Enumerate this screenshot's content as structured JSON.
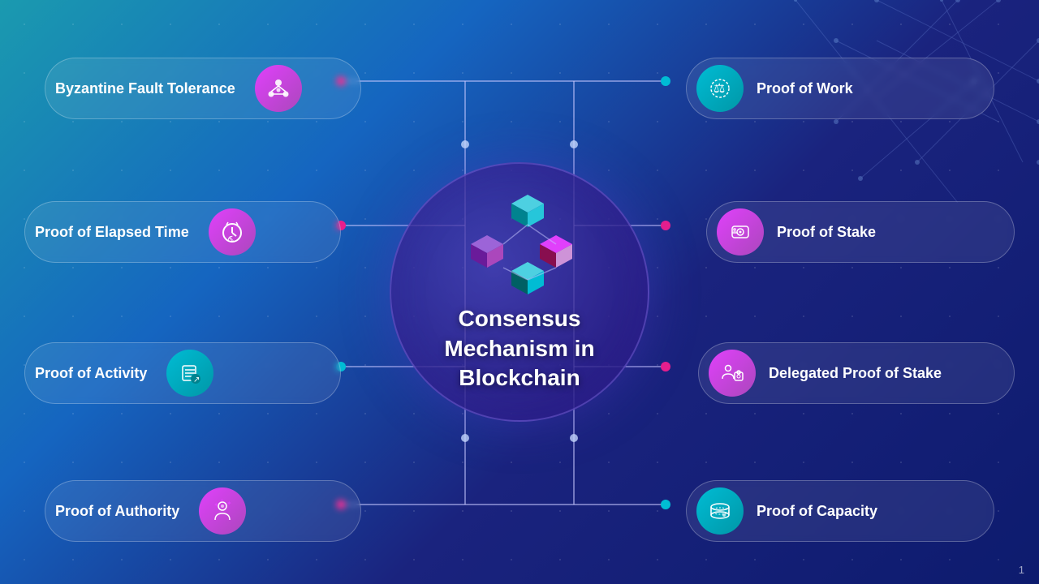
{
  "title": "Consensus Mechanism in Blockchain",
  "center": {
    "line1": "Consensus",
    "line2": "Mechanism in",
    "line3": "Blockchain"
  },
  "cards": {
    "byzantine": "Byzantine Fault Tolerance",
    "proof_of_work": "Proof of Work",
    "proof_of_elapsed_time": "Proof of Elapsed Time",
    "proof_of_stake": "Proof of Stake",
    "proof_of_activity": "Proof of Activity",
    "delegated_proof_of_stake": "Delegated Proof of Stake",
    "proof_of_authority": "Proof of Authority",
    "proof_of_capacity": "Proof of Capacity"
  },
  "page_number": "1",
  "icons": {
    "byzantine": "⚡",
    "proof_of_work": "🔨",
    "proof_of_elapsed_time": "⏱",
    "proof_of_stake": "🔐",
    "proof_of_activity": "🎯",
    "delegated_proof_of_stake": "👥",
    "proof_of_authority": "👤",
    "proof_of_capacity": "💿"
  }
}
